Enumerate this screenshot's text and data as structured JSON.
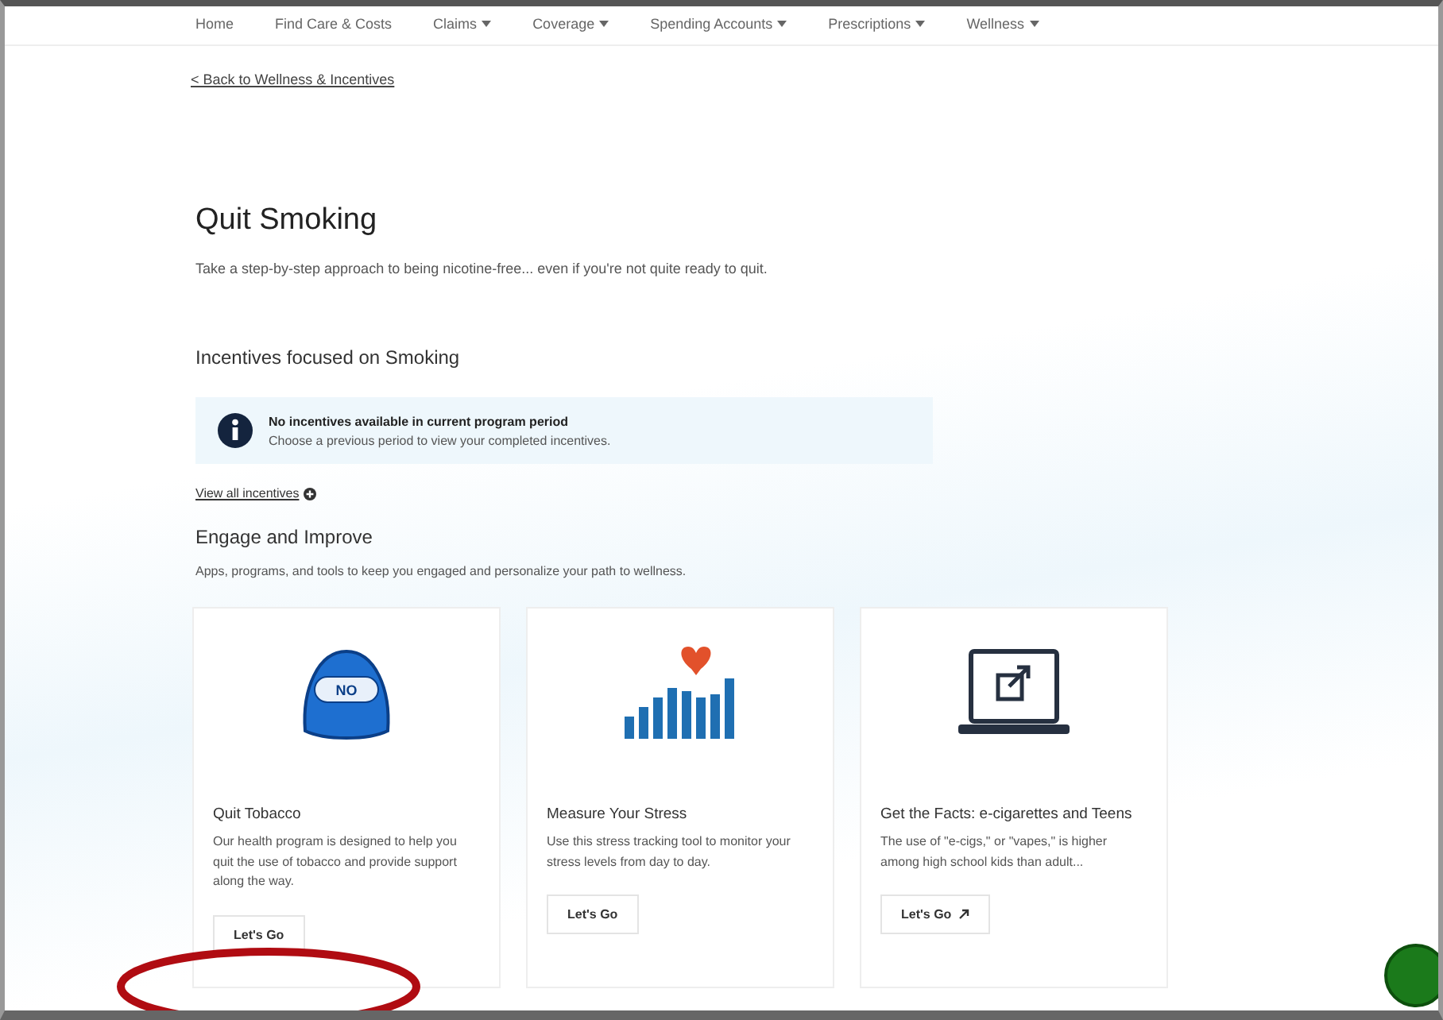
{
  "nav": [
    {
      "label": "Home",
      "dropdown": false
    },
    {
      "label": "Find Care & Costs",
      "dropdown": false
    },
    {
      "label": "Claims",
      "dropdown": true
    },
    {
      "label": "Coverage",
      "dropdown": true
    },
    {
      "label": "Spending Accounts",
      "dropdown": true
    },
    {
      "label": "Prescriptions",
      "dropdown": true
    },
    {
      "label": "Wellness",
      "dropdown": true
    }
  ],
  "back_link": "< Back to Wellness & Incentives",
  "title": "Quit Smoking",
  "subtitle": "Take a step-by-step approach to being nicotine-free... even if you're not quite ready to quit.",
  "incentives": {
    "heading": "Incentives focused on Smoking",
    "alert": {
      "title": "No incentives available in current program period",
      "text": "Choose a previous period to view your completed incentives."
    },
    "link": "View all incentives"
  },
  "engage": {
    "heading": "Engage and Improve",
    "text": "Apps, programs, and tools to keep you engaged and personalize your path to wellness.",
    "cards": [
      {
        "kind": "cap",
        "cap_text": "NO",
        "title": "Quit Tobacco",
        "text": "Our health program is designed to help you quit the use of tobacco and provide support along the way.",
        "button": "Let's Go",
        "external": false
      },
      {
        "kind": "stress",
        "title": "Measure Your Stress",
        "text": "Use this stress tracking tool to monitor your stress levels from day to day.",
        "button": "Let's Go",
        "external": false
      },
      {
        "kind": "laptop",
        "title": "Get the Facts: e-cigarettes and Teens",
        "text": "The use of \"e-cigs,\" or \"vapes,\" is higher among high school kids than adult...",
        "button": "Let's Go",
        "external": true
      }
    ]
  }
}
